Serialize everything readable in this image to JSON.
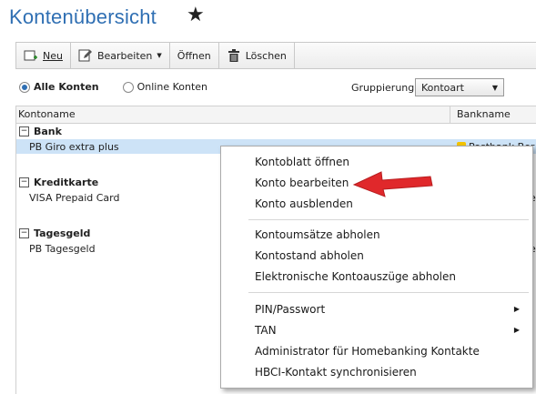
{
  "title": "Kontenübersicht",
  "star": "★",
  "toolbar": {
    "new_label": "Neu",
    "edit_label": "Bearbeiten",
    "edit_dropdown": "▼",
    "open_label": "Öffnen",
    "delete_label": "Löschen"
  },
  "filter": {
    "all_accounts": "Alle Konten",
    "online_accounts": "Online Konten",
    "grouping_label": "Gruppierung",
    "grouping_value": "Kontoart",
    "select_arrow": "▼"
  },
  "table": {
    "headers": {
      "account_name": "Kontoname",
      "bank_name": "Bankname"
    },
    "groups": [
      {
        "toggle": "−",
        "name": "Bank",
        "rows": [
          {
            "name": "PB Giro extra plus",
            "bank": "Postbank Ber"
          }
        ]
      },
      {
        "toggle": "−",
        "name": "Kreditkarte",
        "rows": [
          {
            "name": "VISA Prepaid Card",
            "bank": "er"
          }
        ]
      },
      {
        "toggle": "−",
        "name": "Tagesgeld",
        "rows": [
          {
            "name": "PB Tagesgeld",
            "bank": "er"
          }
        ]
      }
    ]
  },
  "context_menu": {
    "items": [
      {
        "label": "Kontoblatt öffnen"
      },
      {
        "label": "Konto bearbeiten"
      },
      {
        "label": "Konto ausblenden"
      },
      {
        "label": "Kontoumsätze abholen"
      },
      {
        "label": "Kontostand abholen"
      },
      {
        "label": "Elektronische Kontoauszüge abholen"
      },
      {
        "label": "PIN/Passwort",
        "submenu": "▶"
      },
      {
        "label": "TAN",
        "submenu": "▶"
      },
      {
        "label": "Administrator für Homebanking Kontakte"
      },
      {
        "label": "HBCI-Kontakt synchronisieren"
      }
    ]
  },
  "colors": {
    "accent": "#2f6fb3",
    "selection": "#cde3f7",
    "annotation_arrow": "#e0282b"
  }
}
